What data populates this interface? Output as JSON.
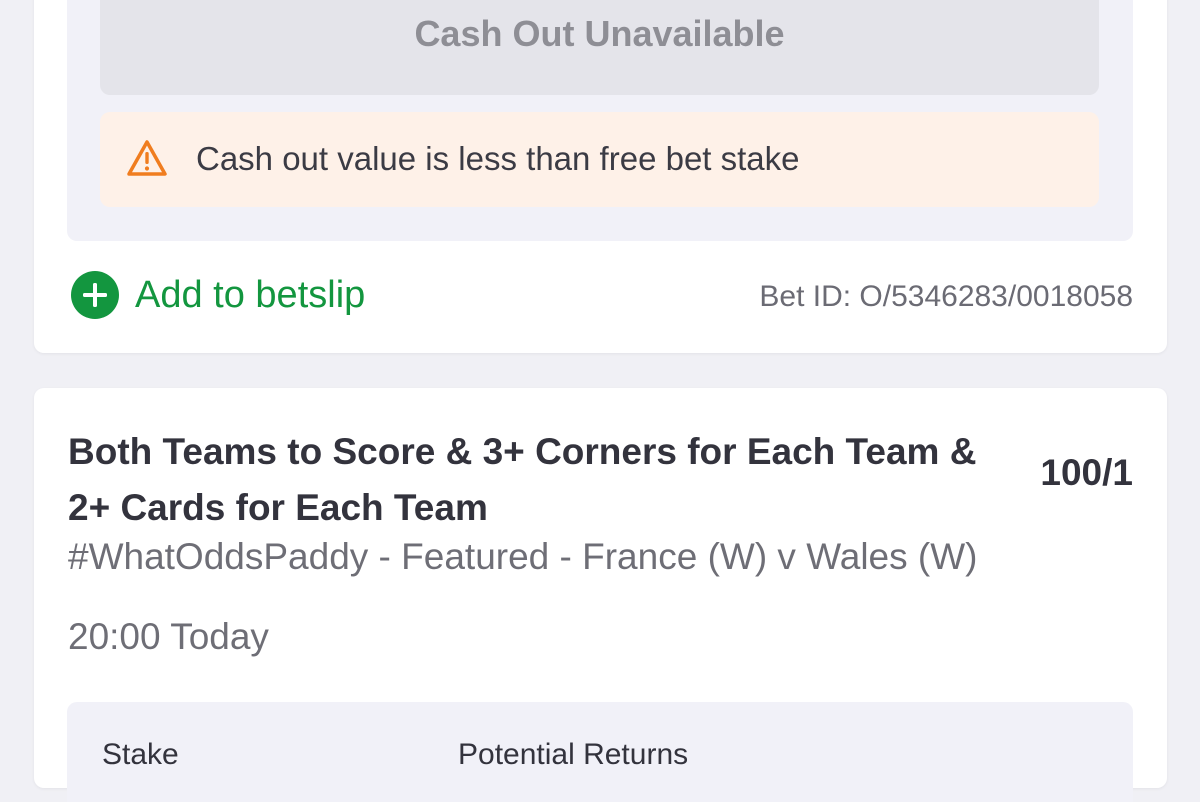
{
  "cashout": {
    "button_label": "Cash Out Unavailable",
    "warning_text": "Cash out value is less than free bet stake"
  },
  "footer": {
    "add_betslip_label": "Add to betslip",
    "bet_id": "Bet ID: O/5346283/0018058"
  },
  "selection": {
    "title": "Both Teams to Score & 3+ Corners for Each Team & 2+ Cards for Each Team",
    "odds": "100/1",
    "event": "#WhatOddsPaddy - Featured - France (W) v Wales (W)",
    "time": "20:00 Today"
  },
  "summary": {
    "stake_label": "Stake",
    "returns_label": "Potential Returns"
  },
  "colors": {
    "accent_green": "#13963f",
    "warning_orange": "#f07d1f",
    "warning_bg": "#fef1e8"
  }
}
